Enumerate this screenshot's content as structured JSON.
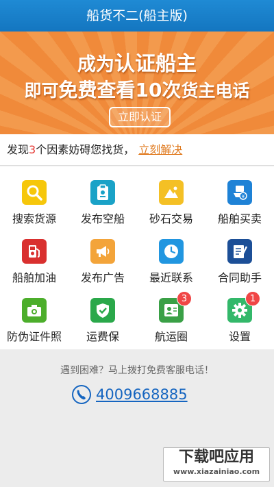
{
  "app": {
    "title": "船货不二(船主版)"
  },
  "banner": {
    "line1_prefix": "成为",
    "line1_emph": "认证船主",
    "line2_prefix": "即可",
    "line2_emph": "免费查看10次",
    "line2_suffix": "货主电话",
    "button_label": "立即认证"
  },
  "notice": {
    "text_prefix": "发现",
    "count": "3",
    "text_suffix": "个因素妨碍您找货，",
    "link_label": "立刻解决"
  },
  "menu": [
    {
      "label": "搜索货源",
      "icon": "search-icon",
      "color": "#f6c70b",
      "badge": ""
    },
    {
      "label": "发布空船",
      "icon": "clipboard-icon",
      "color": "#1aa2c7",
      "badge": ""
    },
    {
      "label": "砂石交易",
      "icon": "mountain-icon",
      "color": "#f4c025",
      "badge": ""
    },
    {
      "label": "船舶买卖",
      "icon": "ship-trade-icon",
      "color": "#1e82d6",
      "badge": ""
    },
    {
      "label": "船舶加油",
      "icon": "fuel-icon",
      "color": "#d9302f",
      "badge": ""
    },
    {
      "label": "发布广告",
      "icon": "megaphone-icon",
      "color": "#f3a43a",
      "badge": ""
    },
    {
      "label": "最近联系",
      "icon": "clock-icon",
      "color": "#2196e0",
      "badge": ""
    },
    {
      "label": "合同助手",
      "icon": "contract-icon",
      "color": "#1c4f97",
      "badge": ""
    },
    {
      "label": "防伪证件照",
      "icon": "camera-icon",
      "color": "#4cae2b",
      "badge": ""
    },
    {
      "label": "运费保",
      "icon": "shield-check-icon",
      "color": "#2aa84a",
      "badge": ""
    },
    {
      "label": "航运圈",
      "icon": "contacts-icon",
      "color": "#3aa046",
      "badge": "3"
    },
    {
      "label": "设置",
      "icon": "gear-icon",
      "color": "#33b86a",
      "badge": "1"
    }
  ],
  "footer": {
    "help_text": "遇到困难？马上拨打免费客服电话！",
    "phone": "4009668885"
  },
  "watermark": {
    "line1": "下载吧应用",
    "line2": "www.xiazainiao.com"
  }
}
